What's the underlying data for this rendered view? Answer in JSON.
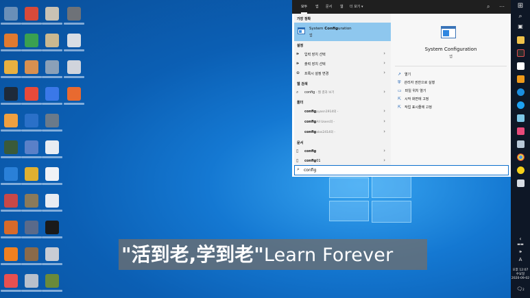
{
  "search": {
    "tabs": [
      "모두",
      "앱",
      "문서",
      "웹",
      "더 보기 ▾"
    ],
    "best_match_header": "가장 정확",
    "best_match": {
      "title_pre": "System ",
      "title_bold": "Config",
      "title_post": "uration",
      "subtitle": "앱"
    },
    "settings_header": "설정",
    "settings": [
      {
        "icon": "speaker-icon",
        "label": "입력 장치 선택"
      },
      {
        "icon": "speaker-icon",
        "label": "출력 장치 선택"
      },
      {
        "icon": "globe-icon",
        "label": "프록시 설정 변경"
      }
    ],
    "web_header": "웹 검색",
    "web_item": {
      "label": "config",
      "sub": " - 웹 결과 보기"
    },
    "folders_header": "폴더",
    "folders": [
      {
        "label": "config",
        "sub": "pyasn1914의 -"
      },
      {
        "label": "config",
        "sub": "All Users의 -"
      },
      {
        "label": "config",
        "sub": "alos2414의 -"
      }
    ],
    "docs_header": "문서",
    "docs": [
      {
        "label": "config"
      },
      {
        "label": "config",
        "suffix": "01"
      }
    ],
    "detail": {
      "title": "System Configuration",
      "subtitle": "앱",
      "actions": [
        "열기",
        "관리자 권한으로 실행",
        "파일 위치 열기",
        "시작 화면에 고정",
        "작업 표시줄에 고정"
      ]
    },
    "query": "config"
  },
  "subtitle": {
    "chinese": "\"活到老,学到老\"",
    "english": "Learn Forever"
  },
  "taskbar": {
    "ime": "A",
    "time": "오후 12:07",
    "day": "수요일",
    "date": "2020-09-02",
    "notification_count": "2"
  },
  "colors": {
    "accent": "#0b6fcc",
    "best_match_bg": "#8ec7ee",
    "taskbar": "#0e1726",
    "search_top": "#1f1f1f"
  }
}
